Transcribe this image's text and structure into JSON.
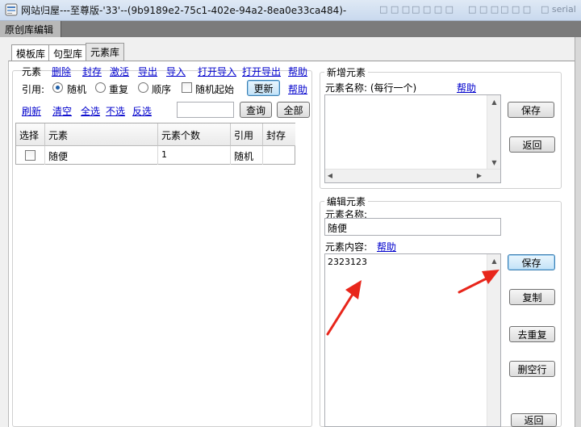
{
  "window": {
    "title": "网站归屋---至尊版-'33'--(9b9189e2-75c1-402e-94a2-8ea0e33ca484)-",
    "title_blur": [
      "□ □ □",
      "□ □ □ □",
      "□ □ □",
      "□ □ □",
      "□ serial"
    ]
  },
  "section_tab": "原创库编辑",
  "tabs": [
    {
      "label": "模板库",
      "active": false
    },
    {
      "label": "句型库",
      "active": false
    },
    {
      "label": "元素库",
      "active": true
    }
  ],
  "element_toolbar": {
    "label": "元素",
    "links": [
      "删除",
      "封存",
      "激活",
      "导出",
      "导入",
      "打开导入",
      "打开导出",
      "帮助"
    ]
  },
  "reference": {
    "label": "引用:",
    "options": [
      {
        "label": "随机",
        "checked": true
      },
      {
        "label": "重复",
        "checked": false
      },
      {
        "label": "顺序",
        "checked": false
      }
    ],
    "random_start_label": "随机起始",
    "random_start_checked": false,
    "refresh_button": "更新",
    "help_link": "帮助"
  },
  "actions": {
    "links": [
      "刷新",
      "清空",
      "全选",
      "不选",
      "反选"
    ],
    "search_value": "",
    "query_button": "查询",
    "all_button": "全部"
  },
  "grid": {
    "columns": [
      "选择",
      "元素",
      "元素个数",
      "引用",
      "封存"
    ],
    "rows": [
      {
        "checked": false,
        "element": "随便",
        "count": "1",
        "reference": "随机",
        "archived": ""
      }
    ]
  },
  "new_element": {
    "title": "新增元素",
    "name_label": "元素名称: (每行一个)",
    "help_link": "帮助",
    "textarea_value": "",
    "save_button": "保存",
    "back_button": "返回"
  },
  "edit_element": {
    "title": "编辑元素",
    "name_label": "元素名称:",
    "name_value": "随便",
    "content_label": "元素内容:",
    "help_link": "帮助",
    "content_value": "2323123",
    "save_button": "保存",
    "copy_button": "复制",
    "dedupe_button": "去重复",
    "delete_blank_button": "删空行",
    "back_button": "返回"
  },
  "colors": {
    "link": "#0000cc",
    "annotation_arrow": "#e8261b",
    "titlebar": "#c9d9ee"
  }
}
